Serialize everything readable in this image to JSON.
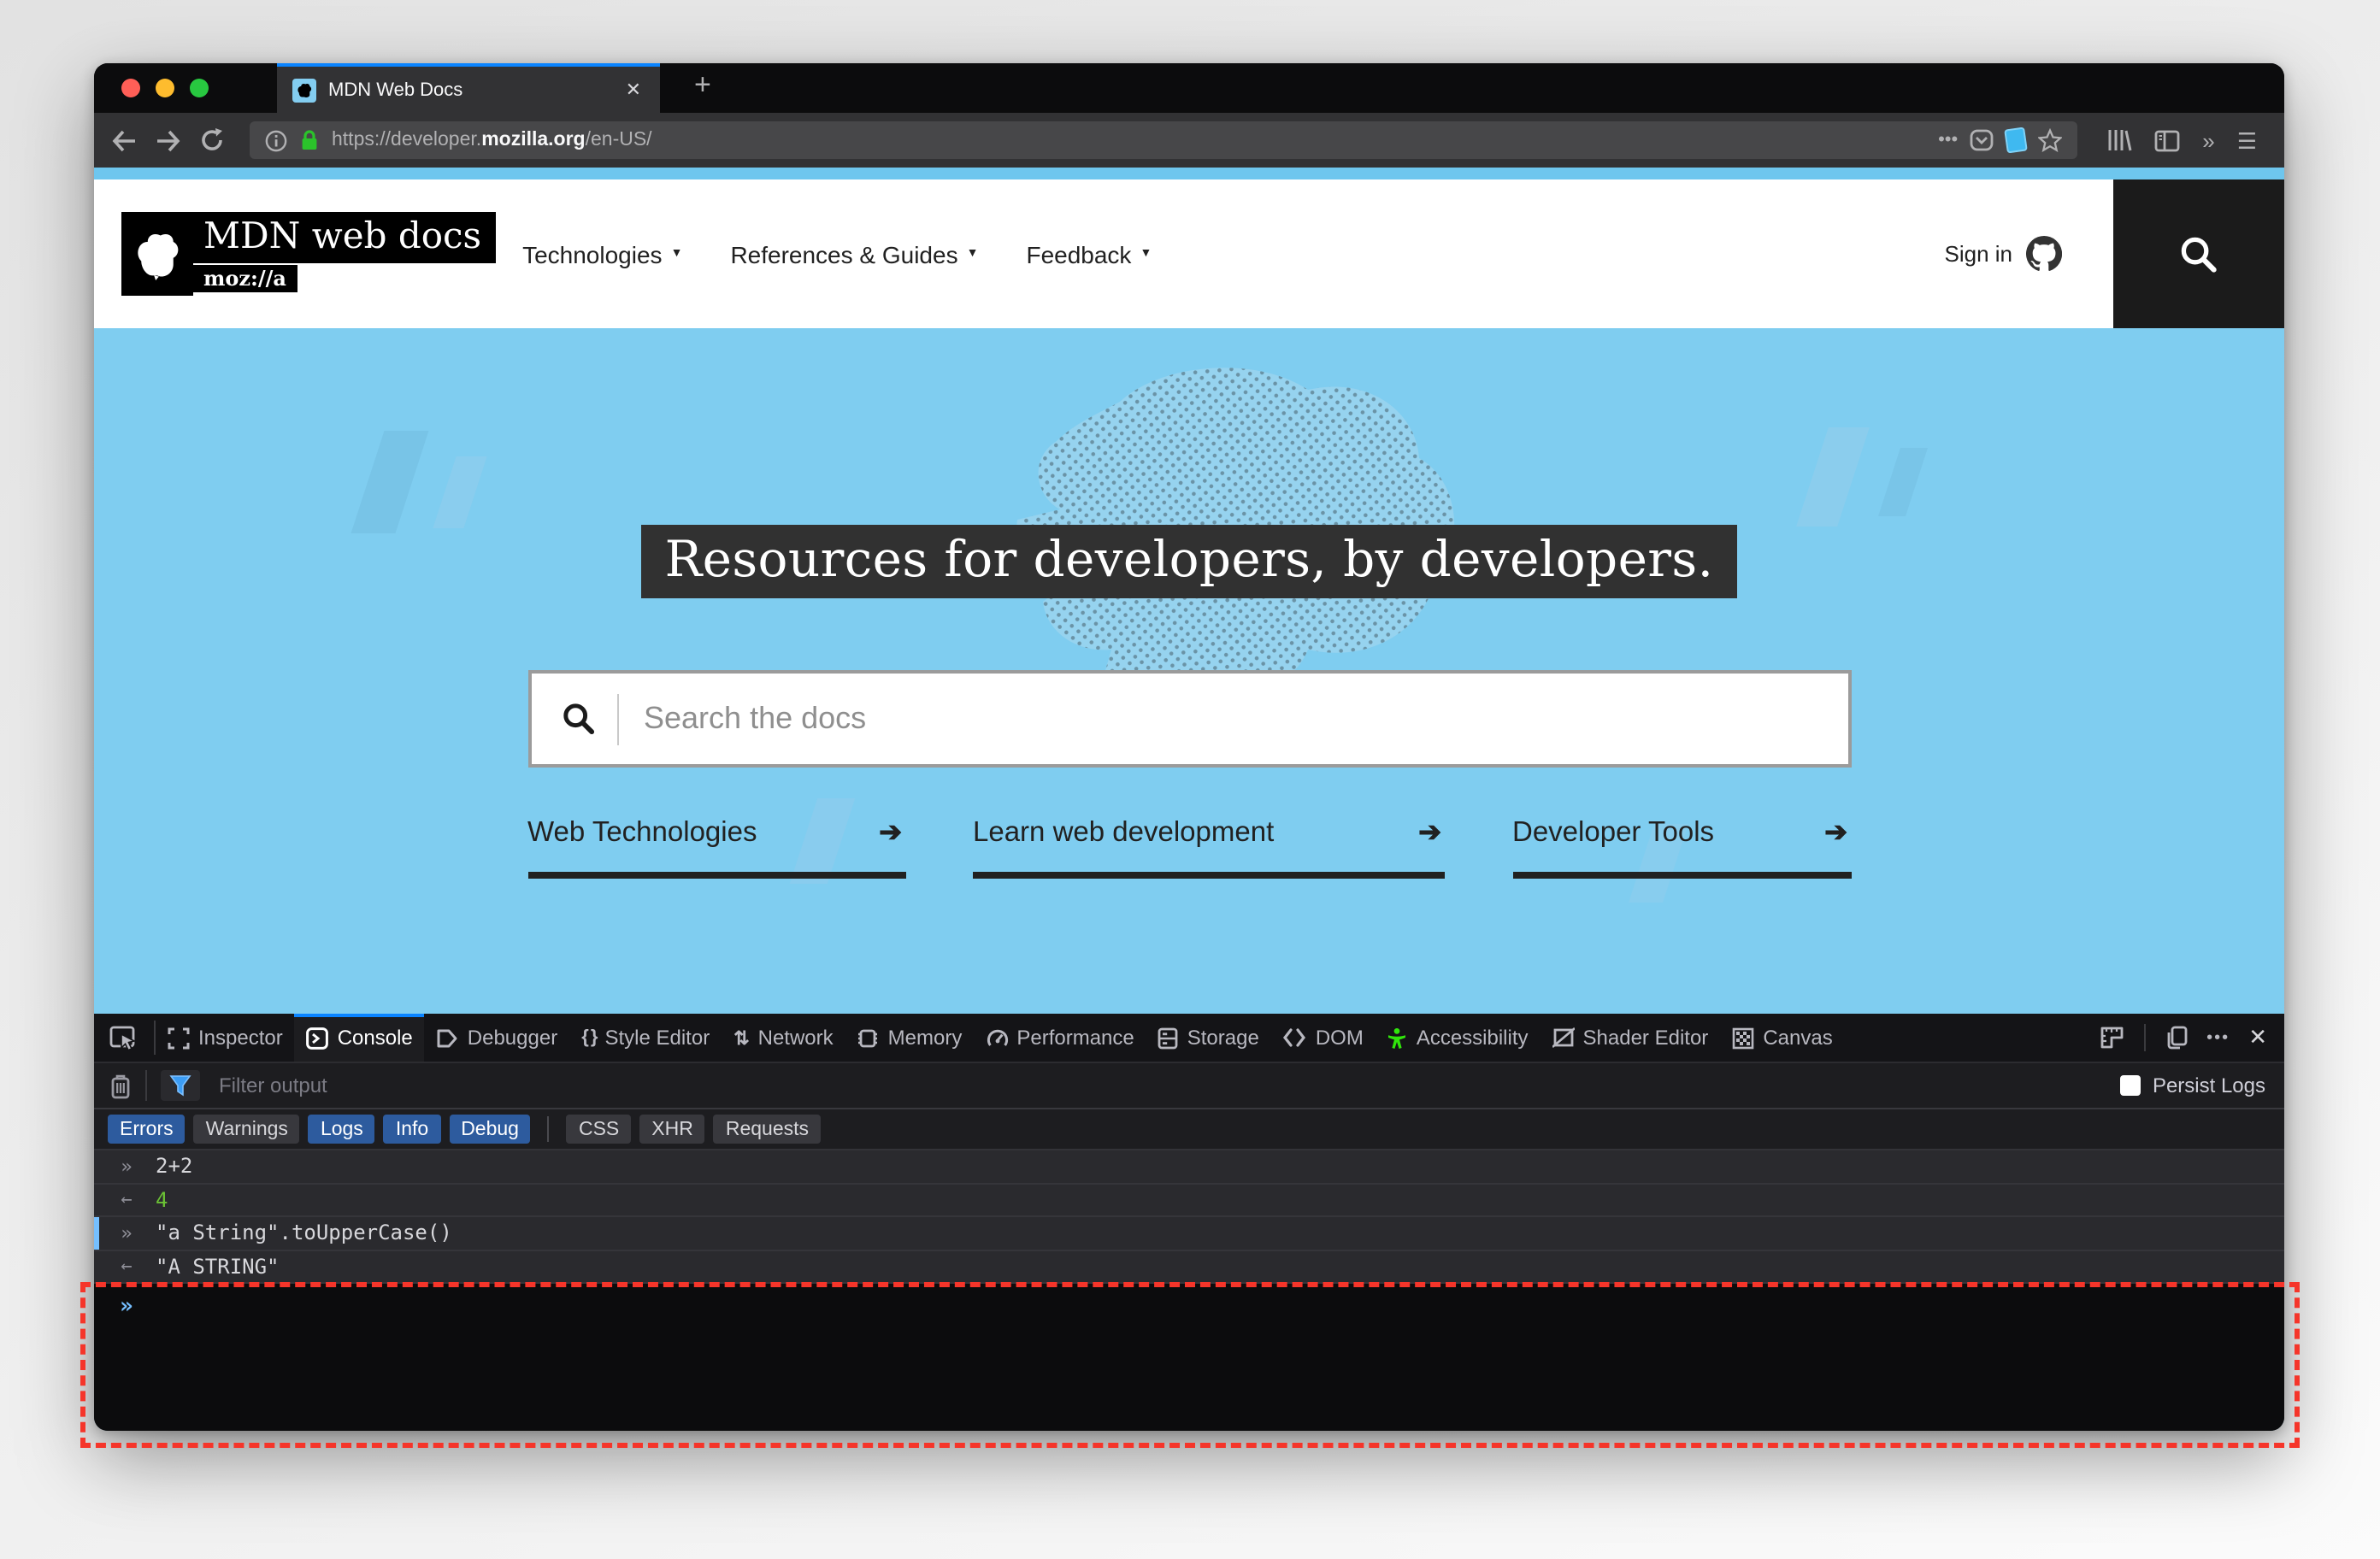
{
  "browser": {
    "tab": {
      "title": "MDN Web Docs",
      "close_glyph": "✕",
      "new_tab_glyph": "+"
    },
    "url": {
      "scheme_prefix": "https://developer.",
      "domain": "mozilla.org",
      "path": "/en-US/"
    },
    "icons": {
      "page_actions_glyph": "•••",
      "overflow_glyph": "»",
      "menu_glyph": "☰"
    }
  },
  "page": {
    "header": {
      "logo_title": "MDN web docs",
      "logo_wordmark": "moz://a",
      "caret_glyph": "▼",
      "nav": [
        {
          "label": "Technologies"
        },
        {
          "label": "References & Guides"
        },
        {
          "label": "Feedback"
        }
      ],
      "sign_in_label": "Sign in"
    },
    "hero": {
      "title": "Resources for developers, by developers.",
      "search_placeholder": "Search the docs",
      "arrow_glyph": "➔",
      "links": [
        {
          "label": "Web Technologies"
        },
        {
          "label": "Learn web development"
        },
        {
          "label": "Developer Tools"
        }
      ]
    },
    "colors": {
      "hero_bg": "#7fcdf0",
      "header_bg": "#ffffff",
      "accent_blue": "#0a84ff"
    }
  },
  "devtools": {
    "tabs": [
      {
        "label": "Inspector",
        "icon": "inspector-icon"
      },
      {
        "label": "Console",
        "icon": "console-icon",
        "active": true
      },
      {
        "label": "Debugger",
        "icon": "debugger-icon"
      },
      {
        "label": "Style Editor",
        "icon": "style-editor-icon",
        "glyph": "{ }"
      },
      {
        "label": "Network",
        "icon": "network-icon",
        "glyph": "⇅"
      },
      {
        "label": "Memory",
        "icon": "memory-icon"
      },
      {
        "label": "Performance",
        "icon": "performance-icon"
      },
      {
        "label": "Storage",
        "icon": "storage-icon"
      },
      {
        "label": "DOM",
        "icon": "dom-icon"
      },
      {
        "label": "Accessibility",
        "icon": "accessibility-icon"
      },
      {
        "label": "Shader Editor",
        "icon": "shader-editor-icon"
      },
      {
        "label": "Canvas",
        "icon": "canvas-icon"
      }
    ],
    "toolbar_icons": {
      "meatball_glyph": "•••",
      "close_glyph": "✕"
    },
    "filter_placeholder": "Filter output",
    "persist_label": "Persist Logs",
    "filters": [
      {
        "label": "Errors",
        "active": true
      },
      {
        "label": "Warnings",
        "active": false
      },
      {
        "label": "Logs",
        "active": true
      },
      {
        "label": "Info",
        "active": true
      },
      {
        "label": "Debug",
        "active": true
      },
      {
        "label": "CSS",
        "active": false
      },
      {
        "label": "XHR",
        "active": false
      },
      {
        "label": "Requests",
        "active": false
      }
    ],
    "console": {
      "entries": [
        {
          "prompt": "»",
          "text": "2+2",
          "kind": "input"
        },
        {
          "prompt": "←",
          "text": "4",
          "kind": "result-number"
        },
        {
          "prompt": "»",
          "text": "\"a String\".toUpperCase()",
          "kind": "input-marked"
        },
        {
          "prompt": "←",
          "text": "\"A STRING\"",
          "kind": "result-string"
        }
      ],
      "input_prompt": "»"
    },
    "colors": {
      "filter_active": "#2d5b9e",
      "result_number": "#6bc235",
      "prompt_blue": "#75bfff",
      "annotation_red": "#f5352a"
    }
  }
}
